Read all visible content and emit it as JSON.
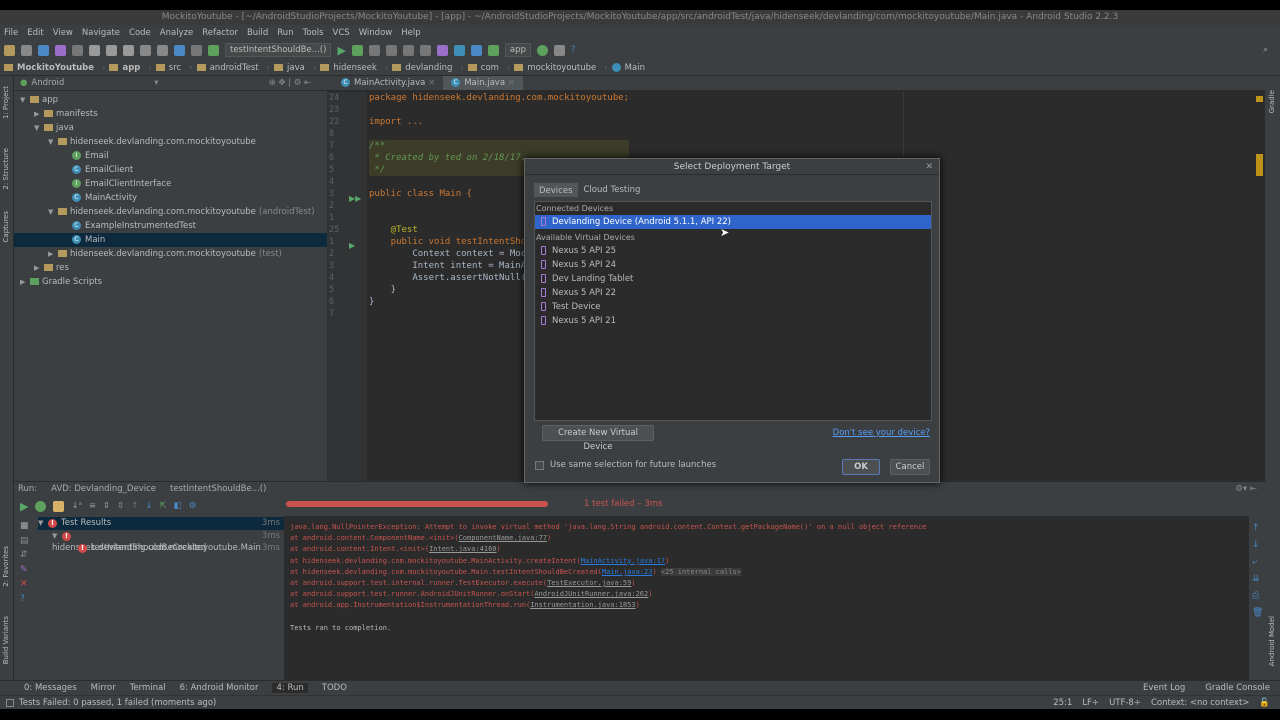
{
  "window_title": "MockitoYoutube - [~/AndroidStudioProjects/MockitoYoutube] - [app] - ~/AndroidStudioProjects/MockitoYoutube/app/src/androidTest/java/hidenseek/devlanding/com/mockitoyoutube/Main.java - Android Studio 2.2.3",
  "menu": [
    "File",
    "Edit",
    "View",
    "Navigate",
    "Code",
    "Analyze",
    "Refactor",
    "Build",
    "Run",
    "Tools",
    "VCS",
    "Window",
    "Help"
  ],
  "toolbar": {
    "run_config": "testIntentShouldBe...()",
    "module": "app"
  },
  "breadcrumbs": [
    "MockitoYoutube",
    "app",
    "src",
    "androidTest",
    "java",
    "hidenseek",
    "devlanding",
    "com",
    "mockitoyoutube",
    "Main"
  ],
  "side_tools": {
    "project": "1: Project",
    "structure": "2: Structure",
    "captures": "Captures",
    "favorites": "2: Favorites",
    "build_variants": "Build Variants",
    "gradle": "Gradle",
    "android_model": "Android Model"
  },
  "project": {
    "view": "Android",
    "tree": [
      {
        "label": "app",
        "depth": 0,
        "arrow": "▼",
        "type": "folder"
      },
      {
        "label": "manifests",
        "depth": 1,
        "arrow": "▶",
        "type": "folder"
      },
      {
        "label": "java",
        "depth": 1,
        "arrow": "▼",
        "type": "folder"
      },
      {
        "label": "hidenseek.devlanding.com.mockitoyoutube",
        "depth": 2,
        "arrow": "▼",
        "type": "folder"
      },
      {
        "label": "Email",
        "depth": 3,
        "arrow": "",
        "type": "interface"
      },
      {
        "label": "EmailClient",
        "depth": 3,
        "arrow": "",
        "type": "class"
      },
      {
        "label": "EmailClientInterface",
        "depth": 3,
        "arrow": "",
        "type": "interface"
      },
      {
        "label": "MainActivity",
        "depth": 3,
        "arrow": "",
        "type": "class"
      },
      {
        "label": "hidenseek.devlanding.com.mockitoyoutube",
        "suffix": "(androidTest)",
        "depth": 2,
        "arrow": "▼",
        "type": "folder"
      },
      {
        "label": "ExampleInstrumentedTest",
        "depth": 3,
        "arrow": "",
        "type": "class"
      },
      {
        "label": "Main",
        "depth": 3,
        "arrow": "",
        "type": "class",
        "selected": true
      },
      {
        "label": "hidenseek.devlanding.com.mockitoyoutube",
        "suffix": "(test)",
        "depth": 2,
        "arrow": "▶",
        "type": "folder"
      },
      {
        "label": "res",
        "depth": 1,
        "arrow": "▶",
        "type": "folder"
      },
      {
        "label": "Gradle Scripts",
        "depth": 0,
        "arrow": "▶",
        "type": "gradle"
      }
    ]
  },
  "editor": {
    "tabs": [
      "MainActivity.java",
      "Main.java"
    ],
    "line_numbers": [
      "24",
      "23",
      "22",
      "8",
      "7",
      "6",
      "5",
      "4",
      "3",
      "2",
      "1",
      "25",
      "1",
      "2",
      "3",
      "4",
      "5",
      "6",
      "7"
    ],
    "code": [
      "package hidenseek.devlanding.com.mockitoyoutube;",
      "",
      "import ...",
      "",
      "/**",
      " * Created by ted on 2/18/17.",
      " */",
      "",
      "public class Main {",
      "",
      "",
      "    @Test",
      "    public void testIntentSho",
      "        Context context = Moc",
      "        Intent intent = MainA",
      "        Assert.assertNotNull(",
      "    }",
      "}",
      ""
    ]
  },
  "dialog": {
    "title": "Select Deployment Target",
    "tabs": [
      "Devices",
      "Cloud Testing"
    ],
    "connected_header": "Connected Devices",
    "connected": [
      "Devlanding Device (Android 5.1.1, API 22)"
    ],
    "virtual_header": "Available Virtual Devices",
    "virtual": [
      "Nexus 5 API 25",
      "Nexus 5 API 24",
      "Dev Landing Tablet",
      "Nexus 5 API 22",
      "Test Device",
      "Nexus 5 API 21"
    ],
    "create_button": "Create New Virtual Device",
    "help_link": "Don't see your device?",
    "checkbox_label": "Use same selection for future launches",
    "ok": "OK",
    "cancel": "Cancel"
  },
  "run": {
    "label": "Run:",
    "tabs": [
      "AVD: Devlanding_Device",
      "testIntentShouldBe...()"
    ],
    "progress": 1.0,
    "status": "1 test failed – 3ms",
    "results": [
      {
        "label": "Test Results",
        "time": "3ms"
      },
      {
        "label": "hidenseek.devlanding.com.mockitoyoutube.Main",
        "time": "3ms"
      },
      {
        "label": "testIntentShouldBeCreated",
        "time": "3ms"
      }
    ],
    "console": [
      {
        "text": "java.lang.NullPointerException: Attempt to invoke virtual method 'java.lang.String android.content.Context.getPackageName()' on a null object reference",
        "link": "",
        "extra": ""
      },
      {
        "text": "at android.content.ComponentName.<init>(",
        "link": "ComponentName.java:77",
        "extra": ""
      },
      {
        "text": "at android.content.Intent.<init>(",
        "link": "Intent.java:4160",
        "extra": ""
      },
      {
        "text": "at hidenseek.devlanding.com.mockitoyoutube.MainActivity.createIntent(",
        "link": "MainActivity.java:17",
        "extra": "",
        "blue": true
      },
      {
        "text": "at hidenseek.devlanding.com.mockitoyoutube.Main.testIntentShouldBeCreated(",
        "link": "Main.java:23",
        "extra": "<25 internal calls>",
        "blue": true
      },
      {
        "text": "at android.support.test.internal.runner.TestExecutor.execute(",
        "link": "TestExecutor.java:59",
        "extra": ""
      },
      {
        "text": "at android.support.test.runner.AndroidJUnitRunner.onStart(",
        "link": "AndroidJUnitRunner.java:262",
        "extra": ""
      },
      {
        "text": "at android.app.Instrumentation$InstrumentationThread.run(",
        "link": "Instrumentation.java:1853",
        "extra": ""
      }
    ],
    "completion": "Tests ran to completion."
  },
  "tool_windows": {
    "left": [
      "0: Messages",
      "Mirror",
      "Terminal",
      "6: Android Monitor",
      "4: Run",
      "TODO"
    ],
    "right": [
      "Event Log",
      "Gradle Console"
    ]
  },
  "status": {
    "message": "Tests Failed: 0 passed, 1 failed (moments ago)",
    "position": "25:1",
    "line_sep": "LF÷",
    "encoding": "UTF-8÷",
    "context": "Context: <no context>"
  }
}
